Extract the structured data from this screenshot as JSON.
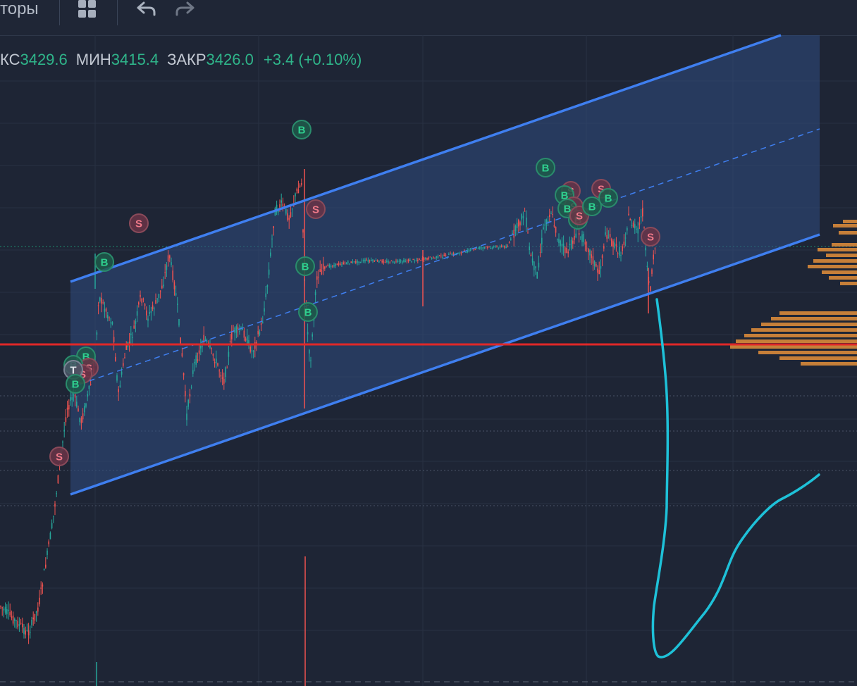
{
  "toolbar": {
    "indicators_label": "торы",
    "icons": [
      "grid-layout-icon",
      "undo-icon",
      "redo-icon"
    ]
  },
  "legend": {
    "max_label": "КС",
    "max_value": "3429.6",
    "min_label": "МИН",
    "min_value": "3415.4",
    "close_label": "ЗАКР",
    "close_value": "3426.0",
    "change": "+3.4 (+0.10%)"
  },
  "colors": {
    "background": "#1e2535",
    "up_candle": "#26a69a",
    "down_candle": "#ef5350",
    "channel_line": "#3f7ff0",
    "channel_fill": "#2f4d80",
    "level_line": "#e02828",
    "volume_profile": "#d88a3a",
    "hand_drawn": "#1ec1d8",
    "buy_marker": "#2fd08f",
    "sell_marker": "#f07a8a"
  },
  "markers": [
    {
      "letter": "B",
      "type": "buy"
    },
    {
      "letter": "S",
      "type": "sell"
    },
    {
      "letter": "B",
      "type": "buy"
    },
    {
      "letter": "S",
      "type": "sell"
    },
    {
      "letter": "B",
      "type": "buy"
    },
    {
      "letter": "B",
      "type": "buy"
    },
    {
      "letter": "B",
      "type": "buy"
    },
    {
      "letter": "S",
      "type": "sell"
    },
    {
      "letter": "B",
      "type": "buy"
    },
    {
      "letter": "S",
      "type": "sell"
    },
    {
      "letter": "B",
      "type": "buy"
    },
    {
      "letter": "S",
      "type": "sell"
    },
    {
      "letter": "B",
      "type": "buy"
    },
    {
      "letter": "B",
      "type": "buy"
    },
    {
      "letter": "S",
      "type": "sell"
    },
    {
      "letter": "B",
      "type": "buy"
    },
    {
      "letter": "S",
      "type": "sell"
    },
    {
      "letter": "B",
      "type": "buy"
    },
    {
      "letter": "S",
      "type": "sell"
    },
    {
      "letter": "B",
      "type": "buy"
    },
    {
      "letter": "S",
      "type": "sell"
    },
    {
      "letter": "T",
      "type": "neutral"
    },
    {
      "letter": "B",
      "type": "buy"
    }
  ]
}
